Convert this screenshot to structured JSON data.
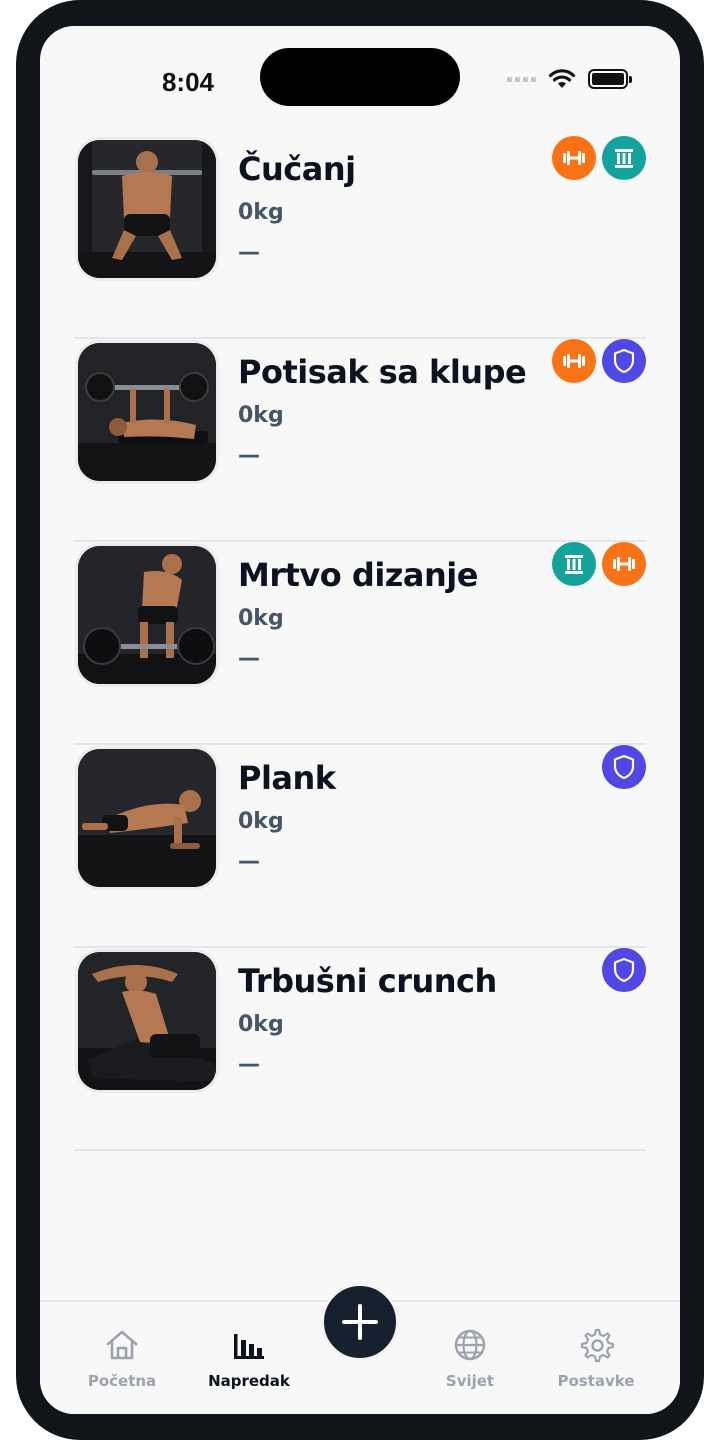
{
  "status_bar": {
    "time": "8:04"
  },
  "exercises": [
    {
      "name": "Čučanj",
      "weight": "0kg",
      "last": "—",
      "badges": [
        "dumbbell-icon",
        "pillar-icon"
      ],
      "badge_colors": [
        "#f97316",
        "#14a39a"
      ]
    },
    {
      "name": "Potisak sa klupe",
      "weight": "0kg",
      "last": "—",
      "badges": [
        "dumbbell-icon",
        "shield-icon"
      ],
      "badge_colors": [
        "#f97316",
        "#5048e5"
      ]
    },
    {
      "name": "Mrtvo dizanje",
      "weight": "0kg",
      "last": "—",
      "badges": [
        "pillar-icon",
        "dumbbell-icon"
      ],
      "badge_colors": [
        "#14a39a",
        "#f97316"
      ]
    },
    {
      "name": "Plank",
      "weight": "0kg",
      "last": "—",
      "badges": [
        "shield-icon"
      ],
      "badge_colors": [
        "#5048e5"
      ]
    },
    {
      "name": "Trbušni crunch",
      "weight": "0kg",
      "last": "—",
      "badges": [
        "shield-icon"
      ],
      "badge_colors": [
        "#5048e5"
      ]
    }
  ],
  "nav": {
    "items": [
      {
        "label": "Početna",
        "icon": "home-icon",
        "active": false
      },
      {
        "label": "Napredak",
        "icon": "bar-chart-icon",
        "active": true
      },
      {
        "label": "Svijet",
        "icon": "globe-icon",
        "active": false
      },
      {
        "label": "Postavke",
        "icon": "gear-icon",
        "active": false
      }
    ],
    "fab_icon": "plus-icon"
  },
  "colors": {
    "accent_orange": "#f97316",
    "accent_teal": "#14a39a",
    "accent_purple": "#5048e5",
    "text_primary": "#0d1220",
    "text_secondary": "#475569"
  }
}
